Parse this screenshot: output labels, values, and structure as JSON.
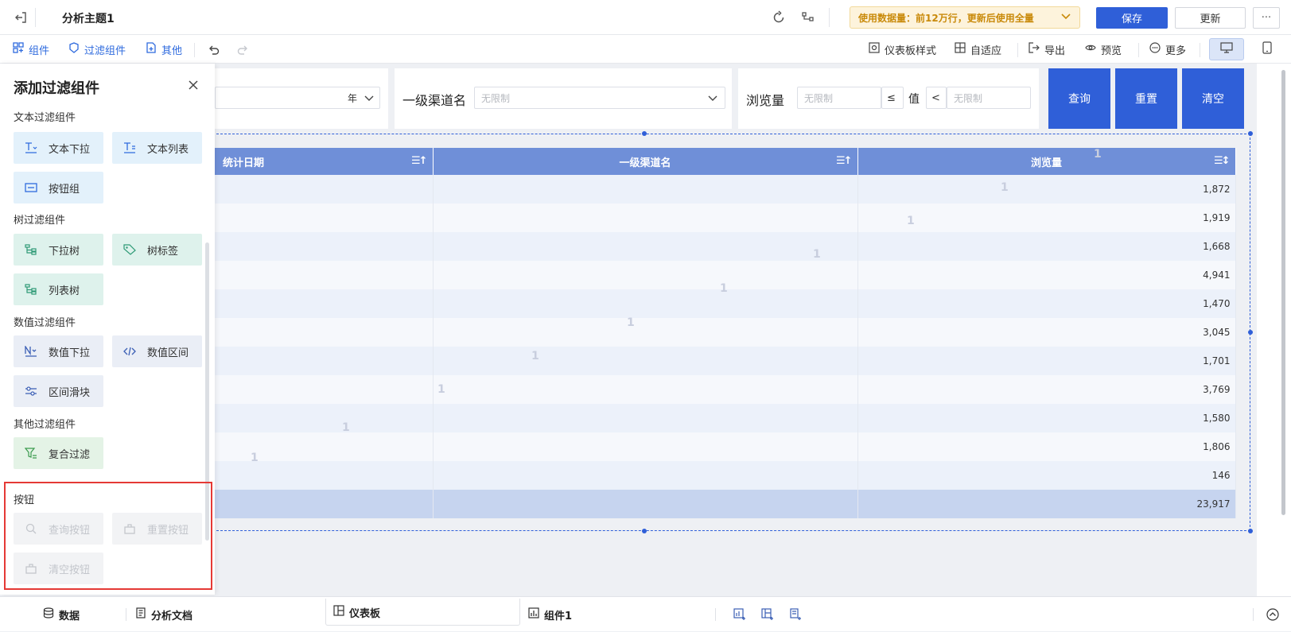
{
  "header": {
    "title": "分析主题1",
    "notice": "使用数据量：前12万行，更新后使用全量",
    "save_label": "保存",
    "update_label": "更新",
    "more_label": "···"
  },
  "toolbar": {
    "left": [
      "组件",
      "过滤组件",
      "其他"
    ],
    "right": [
      "仪表板样式",
      "自适应",
      "导出",
      "预览",
      "更多"
    ]
  },
  "panel": {
    "title": "添加过滤组件",
    "sections": {
      "text": {
        "title": "文本过滤组件",
        "items": [
          "文本下拉",
          "文本列表",
          "按钮组"
        ]
      },
      "tree": {
        "title": "树过滤组件",
        "items": [
          "下拉树",
          "树标签",
          "列表树"
        ]
      },
      "num": {
        "title": "数值过滤组件",
        "items": [
          "数值下拉",
          "数值区间",
          "区间滑块"
        ]
      },
      "other": {
        "title": "其他过滤组件",
        "items": [
          "复合过滤"
        ]
      },
      "button": {
        "title": "按钮",
        "items": [
          "查询按钮",
          "重置按钮",
          "清空按钮"
        ]
      }
    }
  },
  "filters": {
    "year_label": "年",
    "channel_label": "一级渠道名",
    "channel_placeholder": "无限制",
    "views_label": "浏览量",
    "views_min_placeholder": "无限制",
    "views_op1": "≤",
    "value_label": "值",
    "views_op2": "<",
    "views_max_placeholder": "无限制",
    "query": "查询",
    "reset": "重置",
    "clear": "清空"
  },
  "table": {
    "columns": [
      "统计日期",
      "一级渠道名",
      "浏览量"
    ],
    "values": [
      "1,872",
      "1,919",
      "1,668",
      "4,941",
      "1,470",
      "3,045",
      "1,701",
      "3,769",
      "1,580",
      "1,806",
      "146"
    ],
    "total": "23,917",
    "watermark": "1"
  },
  "bottom": {
    "tabs": [
      "数据",
      "分析文档",
      "仪表板",
      "组件1"
    ]
  },
  "colors": {
    "primary": "#2f5fd8",
    "header_row": "#6f8fd8",
    "highlight_border": "#e53935"
  }
}
